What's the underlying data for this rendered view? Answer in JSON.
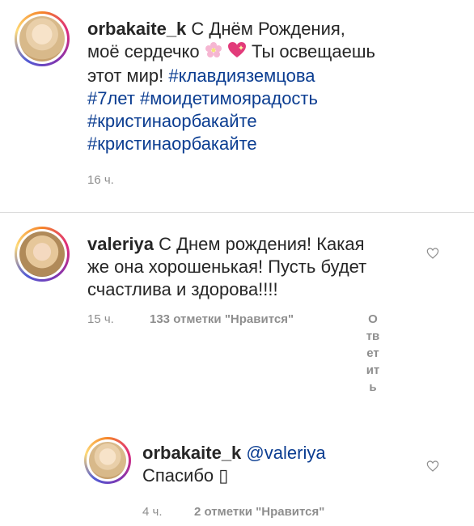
{
  "comments": [
    {
      "username": "orbakaite_k",
      "text_lines": [
        "С Днём Рождения,",
        "моё сердечко",
        "Ты освещаешь",
        "этот мир!"
      ],
      "hashtags": [
        "#клавдияземцова",
        "#7лет",
        "#моидетимоярадость",
        "#кристинаорбакайте",
        "#кристинаорбакайте"
      ],
      "time": "16 ч."
    },
    {
      "username": "valeriya",
      "text_lines": [
        "С Днем рождения! Какая",
        "же она хорошенькая! Пусть будет",
        "счастлива и здорова!!!!"
      ],
      "time": "15 ч.",
      "likes": "133 отметки \"Нравится\"",
      "reply_chars": [
        "О",
        "тв",
        "ет",
        "ит",
        "ь"
      ]
    },
    {
      "username": "orbakaite_k",
      "mention": "@valeriya",
      "text": "Спасибо ",
      "missing_glyph": "▯",
      "time": "4 ч.",
      "likes": "2 отметки \"Нравится\""
    }
  ],
  "icons": {
    "like": "heart-outline-icon",
    "emoji_blossom": "cherry-blossom-icon",
    "emoji_heart": "sparkling-heart-icon"
  },
  "colors": {
    "hashtag": "#0b3d91",
    "meta": "#8e8e8e",
    "text": "#262626"
  }
}
